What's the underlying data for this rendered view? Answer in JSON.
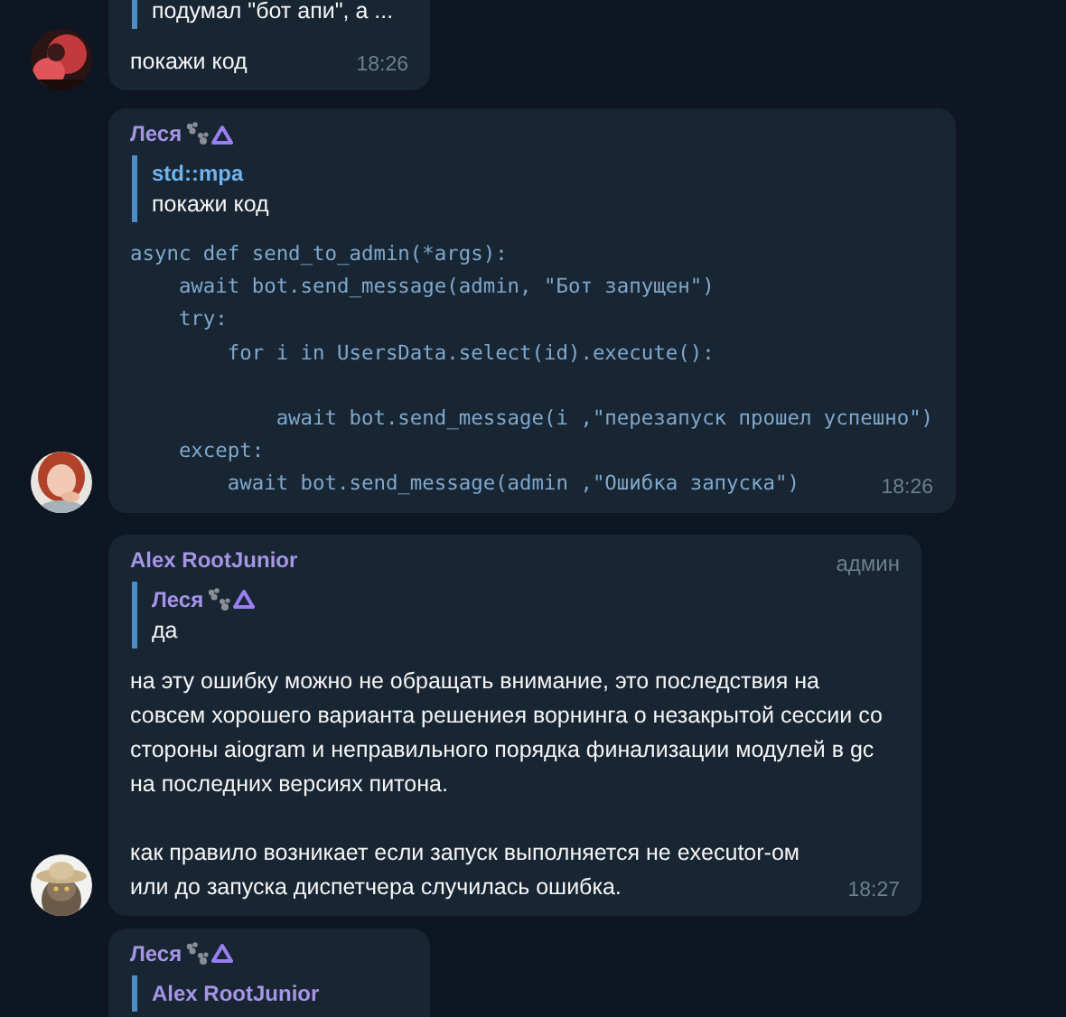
{
  "messages": [
    {
      "avatar": {
        "kind": "picture"
      },
      "reply": {
        "text": "подумал \"бот апи\", а ..."
      },
      "text": [
        "покажи код"
      ],
      "time": "18:26"
    },
    {
      "avatar": {
        "kind": "picture"
      },
      "author": {
        "name": "Леся",
        "color": "#a695e7",
        "status_icons": true
      },
      "reply": {
        "author": "std::mpa",
        "color": "#6fb3ef",
        "text": "покажи код"
      },
      "code": [
        [
          "async def send_to_admin(*args):",
          "    await bot.send_message(admin, \"Бот запущен\")",
          "    try:",
          "        for i in UsersData.select(id).execute():"
        ],
        [
          "            await bot.send_message(i ,\"перезапуск прошел успешно\")",
          "    except:",
          "        await bot.send_message(admin ,\"Ошибка запуска\")"
        ]
      ],
      "time": "18:26"
    },
    {
      "avatar": {
        "kind": "picture"
      },
      "author": {
        "name": "Alex RootJunior",
        "color": "#a695e7",
        "status_icons": false
      },
      "role": "админ",
      "reply": {
        "author": "Леся",
        "color": "#a695e7",
        "status_icons": true,
        "text": "да"
      },
      "text": [
        "на эту ошибку можно не обращать внимание, это последствия на совсем хорошего варианта решениея ворнинга о незакрытой сессии со стороны aiogram и неправильного порядка финализации модулей в gc на последних версиях питона.",
        "как правило возникает если запуск выполняется не executor-ом или до запуска диспетчера случилась ошибка."
      ],
      "time": "18:27"
    },
    {
      "author": {
        "name": "Леся",
        "color": "#a695e7",
        "status_icons": true
      },
      "reply": {
        "author": "Alex RootJunior",
        "color": "#a695e7"
      }
    }
  ]
}
